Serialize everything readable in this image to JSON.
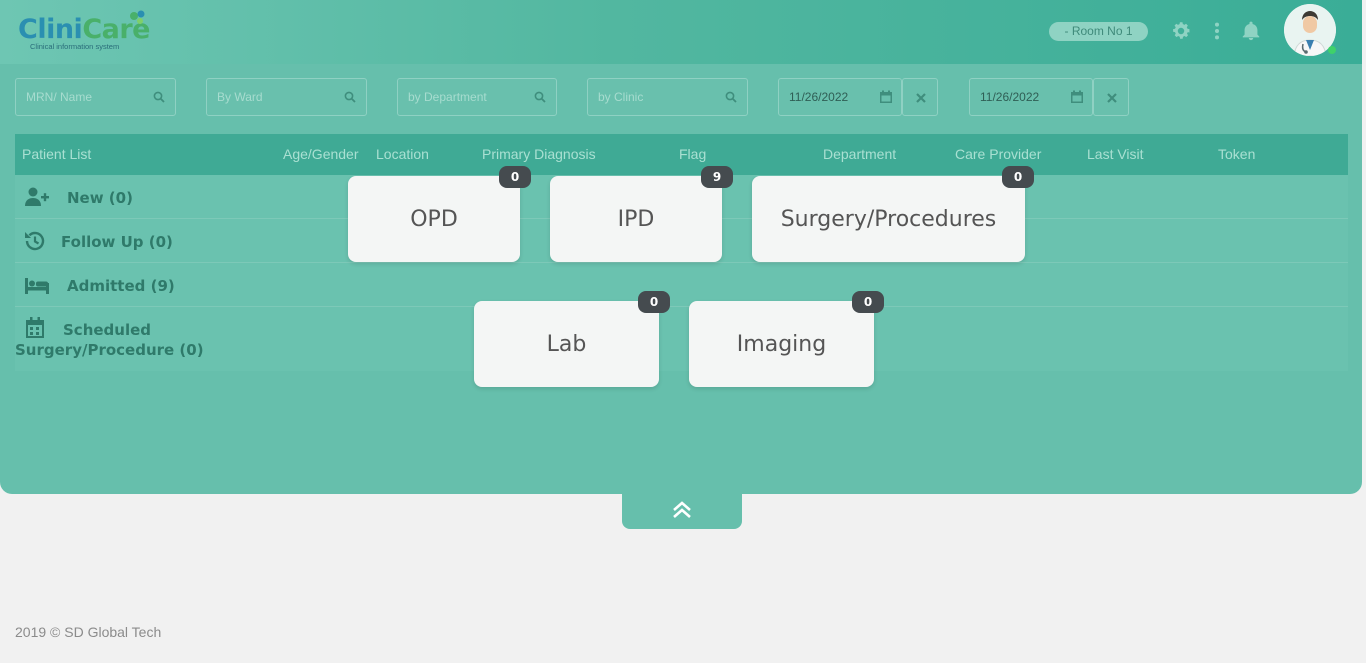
{
  "brand": {
    "logo_part1": "Clini",
    "logo_part2": "Care",
    "tagline": "Clinical information system"
  },
  "header": {
    "room_label": "-  Room No 1",
    "icons": [
      "gear-icon",
      "more-vertical-icon",
      "bell-icon",
      "doctor-avatar"
    ]
  },
  "filters": {
    "mrn_placeholder": "MRN/ Name",
    "ward_placeholder": "By Ward",
    "department_placeholder": "by Department",
    "clinic_placeholder": "by Clinic",
    "date_from": "11/26/2022",
    "date_to": "11/26/2022"
  },
  "table": {
    "columns": [
      "Patient List",
      "Age/Gender",
      "Location",
      "Primary Diagnosis",
      "Flag",
      "Department",
      "Care Provider",
      "Last Visit",
      "Token"
    ]
  },
  "patient_list": {
    "new": "New (0)",
    "follow_up": "Follow Up (0)",
    "admitted": "Admitted (9)",
    "scheduled_line1": "Scheduled",
    "scheduled_line2": "Surgery/Procedure (0)"
  },
  "cards": [
    {
      "label": "OPD",
      "count": "0"
    },
    {
      "label": "IPD",
      "count": "9"
    },
    {
      "label": "Surgery/Procedures",
      "count": "0"
    },
    {
      "label": "Lab",
      "count": "0"
    },
    {
      "label": "Imaging",
      "count": "0"
    }
  ],
  "footer": {
    "copyright": "2019 © SD Global Tech"
  },
  "colors": {
    "panel": "#66bfac",
    "header_dark": "#3aad97",
    "badge": "#454b4f",
    "card": "#f4f6f5"
  }
}
